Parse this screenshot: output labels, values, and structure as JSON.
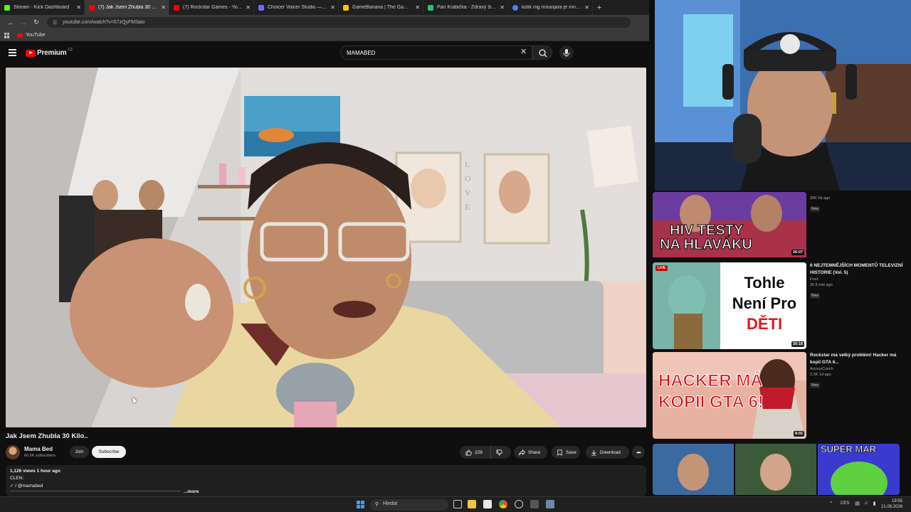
{
  "browser": {
    "tabs": [
      {
        "label": "Stream - Kick Dashboard",
        "favicon_color": "#53fc18",
        "active": false
      },
      {
        "label": "(7) Jak Jsem Zhubla 30 Kilo.. - Y",
        "favicon_color": "#ff0000",
        "active": true
      },
      {
        "label": "(7) Rockstar Games - YouTube",
        "favicon_color": "#ff0000",
        "active": false
      },
      {
        "label": "Choicer Voicer Studio — Free C",
        "favicon_color": "#6b6bff",
        "active": false
      },
      {
        "label": "GameBanana | The Game Mode",
        "favicon_color": "#f7c600",
        "active": false
      },
      {
        "label": "Pan Krabička - Zdravý životní st",
        "favicon_color": "#2fbf71",
        "active": false
      },
      {
        "label": "kolik mg mounjara je mnax - Go",
        "favicon_color": "#4285f4",
        "active": false
      }
    ],
    "close_glyph": "✕",
    "new_tab_glyph": "+",
    "url": "youtube.com/watch?v=57zQyFM3aio",
    "bookmark_label": "YouTube"
  },
  "masthead": {
    "logo_word": "Premium",
    "country_code": "CZ",
    "search_value": "MAMABED",
    "clear_glyph": "✕"
  },
  "video": {
    "title": "Jak Jsem Zhubla 30 Kilo..",
    "channel_name": "Mama Bed",
    "subscribers": "60.6K subscribers",
    "join_label": "Join",
    "subscribe_label": "Subscribe",
    "like_count": "228",
    "share_label": "Share",
    "save_label": "Save",
    "download_label": "Download",
    "more_glyph": "•••"
  },
  "description": {
    "meta": "1,126 views  1 hour ago",
    "line1": "CLEN:",
    "link_prefix": "✓ / ",
    "link": "@mamabed",
    "more_label": "...more"
  },
  "recommendations": [
    {
      "thumb_text": [
        "HIV TESTY",
        "NA HLAVÁKU"
      ],
      "duration": "36:07",
      "title": "",
      "channel": "",
      "meta": "30K  5d ago",
      "badge": "New",
      "live": false
    },
    {
      "thumb_text": [
        "Tohle",
        "Není Pro",
        "DĚTI"
      ],
      "duration": "30:18",
      "title": "6 NEJTEMNĚJŠÍCH MOMENTŮ TELEVIZNÍ HISTORIE (Vol. 5)",
      "channel": "Frizz",
      "meta": "36  8 min ago",
      "badge": "New",
      "live": true,
      "live_label": "LIVE"
    },
    {
      "thumb_text": [
        "HACKER MÁ",
        "KOPII GTA 6!"
      ],
      "duration": "8:02",
      "title": "Rockstar má velký problém! Hacker má kopii GTA 6...",
      "channel": "ArcousCzech",
      "meta": "3.2K  1d ago",
      "badge": "New",
      "live": false
    },
    {
      "thumb_text": [
        "SUPER MAR"
      ],
      "duration": "",
      "title": "",
      "channel": "",
      "meta": "",
      "badge": "",
      "live": false
    }
  ],
  "taskbar": {
    "search_placeholder": "Hledat",
    "search_icon": "search-icon",
    "lang": "CES",
    "time": "19:55",
    "date": "21.08.2026"
  },
  "colors": {
    "bg": "#0f0f0f",
    "youtube_red": "#ff0000",
    "chrome_dark": "#1f1f1f",
    "chrome_mid": "#3a3a3a"
  }
}
